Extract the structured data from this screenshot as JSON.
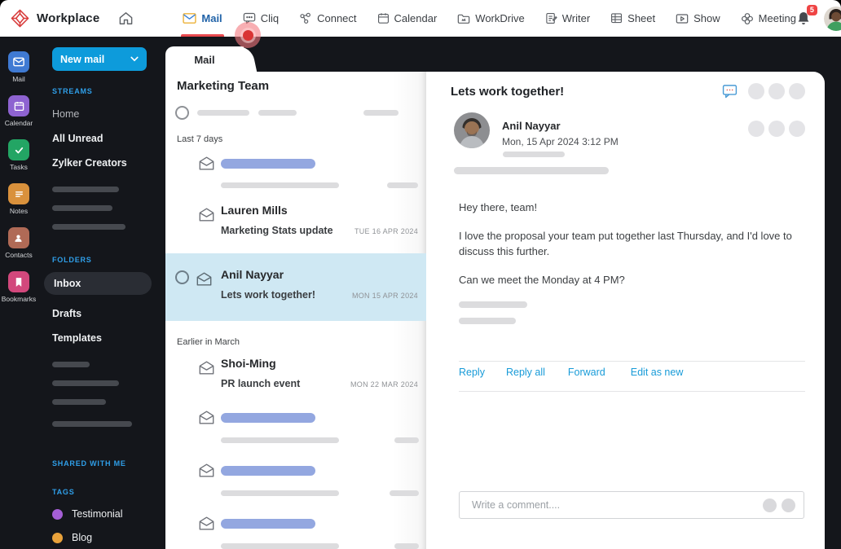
{
  "header": {
    "brand": "Workplace",
    "nav": [
      {
        "label": "Mail",
        "active": true
      },
      {
        "label": "Cliq"
      },
      {
        "label": "Connect"
      },
      {
        "label": "Calendar"
      },
      {
        "label": "WorkDrive"
      },
      {
        "label": "Writer"
      },
      {
        "label": "Sheet"
      },
      {
        "label": "Show"
      },
      {
        "label": "Meeting"
      }
    ],
    "notification_count": "5"
  },
  "app_rail": {
    "items": [
      {
        "label": "Mail",
        "color": "#3f7ad3",
        "active": true
      },
      {
        "label": "Calendar",
        "color": "#8e63d1"
      },
      {
        "label": "Tasks",
        "color": "#23a564"
      },
      {
        "label": "Notes",
        "color": "#d9913c"
      },
      {
        "label": "Contacts",
        "color": "#b06a56"
      },
      {
        "label": "Bookmarks",
        "color": "#d2487c"
      }
    ]
  },
  "sidebar": {
    "new_mail_label": "New mail",
    "sections": {
      "streams": "STREAMS",
      "folders": "FOLDERS",
      "shared": "SHARED WITH ME",
      "tags": "TAGS"
    },
    "streams": [
      {
        "label": "Home"
      },
      {
        "label": "All Unread"
      },
      {
        "label": "Zylker Creators"
      }
    ],
    "folders": [
      {
        "label": "Inbox",
        "selected": true
      },
      {
        "label": "Drafts"
      },
      {
        "label": "Templates"
      }
    ],
    "tags": [
      {
        "label": "Testimonial",
        "color": "#a55fd6"
      },
      {
        "label": "Blog",
        "color": "#e9a23b"
      }
    ]
  },
  "mail_list": {
    "tab_label": "Mail",
    "title": "Marketing Team",
    "groups": [
      {
        "label": "Last 7 days",
        "items": [
          {
            "type": "skeleton"
          },
          {
            "type": "mail",
            "sender": "Lauren Mills",
            "subject": "Marketing Stats update",
            "date": "TUE 16 APR 2024"
          },
          {
            "type": "mail",
            "sender": "Anil Nayyar",
            "subject": "Lets work together!",
            "date": "MON 15 APR 2024",
            "selected": true
          }
        ]
      },
      {
        "label": "Earlier in March",
        "items": [
          {
            "type": "mail",
            "sender": "Shoi-Ming",
            "subject": "PR launch event",
            "date": "MON 22 MAR 2024"
          },
          {
            "type": "skeleton"
          },
          {
            "type": "skeleton"
          },
          {
            "type": "skeleton"
          }
        ]
      }
    ]
  },
  "mail_detail": {
    "subject": "Lets work together!",
    "sender_name": "Anil Nayyar",
    "sent_at": "Mon, 15 Apr 2024  3:12 PM",
    "body": [
      "Hey there, team!",
      "I love the proposal your team put together last Thursday, and I'd love to discuss this further.",
      "Can we meet the Monday at 4 PM?"
    ],
    "actions": [
      {
        "label": "Reply"
      },
      {
        "label": "Reply all"
      },
      {
        "label": "Forward"
      },
      {
        "label": "Edit as new"
      }
    ],
    "comment_placeholder": "Write a comment...."
  },
  "colors": {
    "accent_blue": "#0d9bdb",
    "link_blue": "#189bd8",
    "active_nav_blue": "#2163a8",
    "active_underline_red": "#e8494e",
    "selected_row_blue": "#cfe8f3",
    "skeleton_blue": "#93a7e0",
    "sidebar_bg": "#14161b",
    "badge_red": "#ef4444",
    "tag_purple": "#a55fd6",
    "tag_orange": "#e9a23b"
  }
}
